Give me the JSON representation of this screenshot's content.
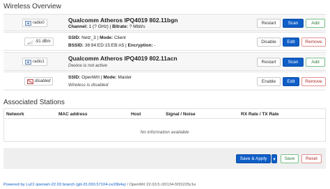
{
  "wireless": {
    "title": "Wireless Overview",
    "devices": [
      {
        "chip": "radio0",
        "title": "Qualcomm Atheros IPQ4019 802.11bgn",
        "line1": {
          "channel_label": "Channel:",
          "channel": "1 (? GHz)",
          "sep": "|",
          "bitrate_label": "Bitrate:",
          "bitrate": "? Mbit/s"
        },
        "buttons": {
          "restart": "Restart",
          "scan": "Scan",
          "add": "Add"
        }
      },
      {
        "chip": "-91 dBm",
        "ssid_label": "SSID:",
        "ssid": "Netz_3",
        "mode_label": "Mode:",
        "mode": "Client",
        "bssid_label": "BSSID:",
        "bssid": "38:94:ED:15:EB:A5",
        "enc_label": "Encryption:",
        "enc": "-",
        "buttons": {
          "disable": "Disable",
          "edit": "Edit",
          "remove": "Remove"
        }
      },
      {
        "chip": "radio1",
        "title": "Qualcomm Atheros IPQ4019 802.11acn",
        "status": "Device is not active",
        "buttons": {
          "restart": "Restart",
          "scan": "Scan",
          "add": "Add"
        }
      },
      {
        "chip": "disabled",
        "ssid_label": "SSID:",
        "ssid": "OpenWrt",
        "mode_label": "Mode:",
        "mode": "Master",
        "status": "Wireless is disabled",
        "buttons": {
          "enable": "Enable",
          "edit": "Edit",
          "remove": "Remove"
        }
      }
    ]
  },
  "stations": {
    "title": "Associated Stations",
    "columns": [
      "Network",
      "MAC address",
      "Host",
      "Signal / Noise",
      "RX Rate / TX Rate"
    ],
    "empty": "No information available"
  },
  "actions": {
    "save_apply": "Save & Apply",
    "dropdown": "▾",
    "save": "Save",
    "reset": "Reset"
  },
  "footer": {
    "powered": "Powered by LuCI openwrt-22.03 branch (git-23.093.57104-ce20b4a)",
    "rest": " / OpenWrt 22.03.5 r20134-5f15225c1e"
  },
  "colors": {
    "primary": "#0f5ec7",
    "add": "#2b7a3a",
    "remove": "#b02a2a"
  },
  "icons": {
    "radio": "wifi-icon",
    "signal": "signal-icon",
    "disabled": "wifi-disabled-icon"
  }
}
